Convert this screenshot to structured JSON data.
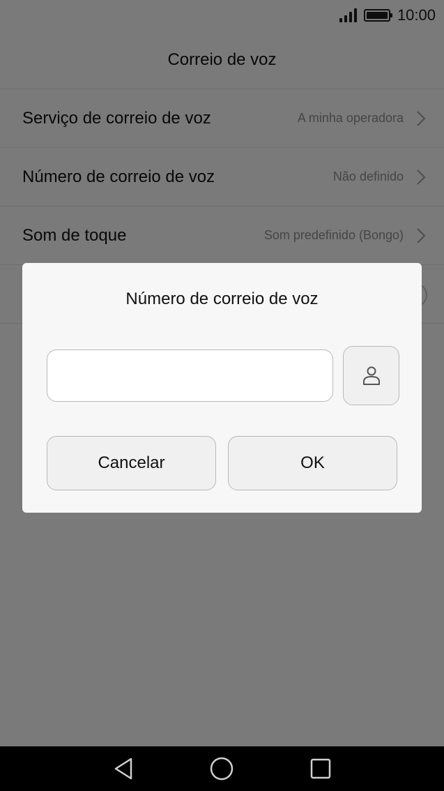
{
  "status_bar": {
    "time": "10:00",
    "signal_icon": "signal-bars-icon",
    "battery_icon": "battery-full-icon",
    "battery_level": 1.0
  },
  "header": {
    "title": "Correio de voz"
  },
  "settings": {
    "items": [
      {
        "label": "Serviço de correio de voz",
        "value": "A minha operadora"
      },
      {
        "label": "Número de correio de voz",
        "value": "Não definido"
      },
      {
        "label": "Som de toque",
        "value": "Som predefinido (Bongo)"
      }
    ]
  },
  "dialog": {
    "title": "Número de correio de voz",
    "input_value": "",
    "contact_icon": "person-icon",
    "cancel_label": "Cancelar",
    "ok_label": "OK"
  },
  "navigation": {
    "back_icon": "back-triangle-icon",
    "home_icon": "home-circle-icon",
    "recent_icon": "recent-apps-square-icon"
  },
  "colors": {
    "background": "#f5f5f5",
    "overlay": "#000000",
    "dialog_background": "#f7f7f7",
    "secondary_text": "#8a8a8a",
    "nav_bar": "#000000"
  }
}
